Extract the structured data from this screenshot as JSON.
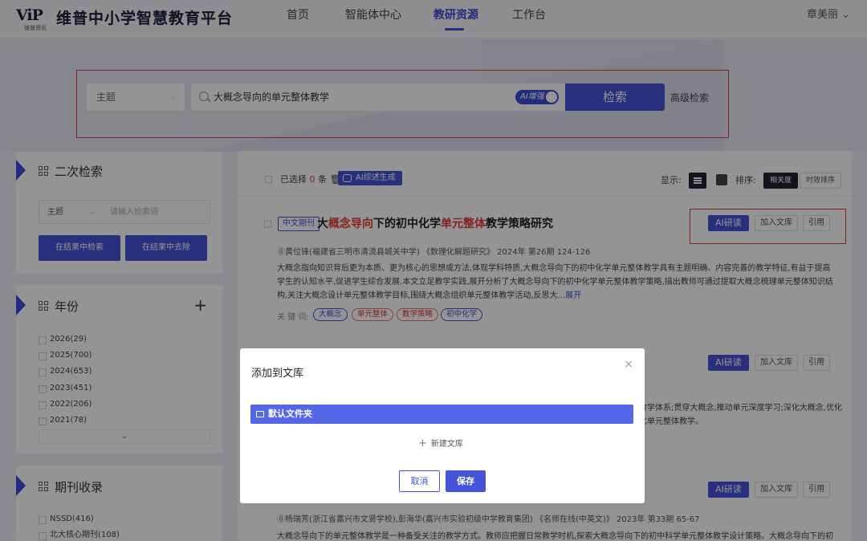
{
  "header": {
    "logo_mark": "ViP",
    "logo_sub": "维普资讯",
    "title": "维普中小学智慧教育平台",
    "nav": [
      "首页",
      "智能体中心",
      "教研资源",
      "工作台"
    ],
    "active_nav": "教研资源",
    "user": "章美丽 ⌄"
  },
  "search": {
    "subject": "主题",
    "query": "大概念导向的单元整体教学",
    "ai_toggle": "AI增强",
    "button": "检索",
    "advanced": "高级检索"
  },
  "sidebar": {
    "secondary": {
      "title": "二次检索",
      "field": "主题",
      "placeholder": "请输入检索词",
      "btn_in": "在结果中检索",
      "btn_out": "在结果中去除"
    },
    "year": {
      "title": "年份",
      "items": [
        "2026(29)",
        "2025(700)",
        "2024(653)",
        "2023(451)",
        "2022(206)",
        "2021(78)"
      ]
    },
    "journal": {
      "title": "期刊收录",
      "items": [
        "NSSD(416)",
        "北大核心期刊(108)"
      ]
    }
  },
  "toolbar": {
    "selected_prefix": "已选择",
    "selected_count": "0",
    "selected_suffix": "条",
    "ai_summary": "AI综述生成",
    "display_label": "显示:",
    "sort_label": "排序:",
    "sort_relevance": "相关度",
    "sort_time": "时效排序"
  },
  "results": [
    {
      "tag": "中文期刊",
      "title_parts": [
        "大",
        "概念导向",
        "下的初中化学",
        "单元整体",
        "教学策略研究"
      ],
      "meta": "⓪黄位锋(福建省三明市清流县城关中学)   《数理化解题研究》   2024年 第26期 124-126",
      "abstract": "大概念指向知识背后更为本质、更为核心的思想或方法,体现学科特质,大概念导向下的初中化学单元整体教学具有主题明确、内容完善的教学特征,有益于提高学生的认知水平,促进学生综合发展.本文立足教学实践,展开分析了大概念导向下的初中化学单元整体教学策略,描出教师可通过提取大概念梳理单元整体知识结构,关注大概念设计单元整体教学目标,围绕大概念组织单元整体教学活动,反思大...",
      "more": "展开",
      "kw_label": "关 键 词:",
      "keywords": [
        "大概念",
        "单元整体",
        "教学策略",
        "初中化学"
      ],
      "ai_read": "AI研读",
      "add_lib": "加入文库",
      "cite": "引用"
    },
    {
      "ai_read": "AI研读",
      "add_lib": "加入文库",
      "cite": "引用",
      "abstract_frag_1": "教学体系;贯穿大概念,推动单元深度学习;深化大概念,优化",
      "abstract_frag_2": "化单元整体教学。"
    },
    {
      "ai_read": "AI研读",
      "add_lib": "加入文库",
      "cite": "引用",
      "meta": "⓪杨瑞芳(浙江省嘉兴市文贤学校),彭海华(嘉兴市实验初级中学教育集团)   《名师在线(中英文)》   2023年 第33期 65-67",
      "abstract": "大概念导向下的单元整体教学是一种备受关注的教学方式。教师应把握日常教学时机,探索大概念导向下的初中科学单元整体教学设计策略。大概念导向下的初中科学单元整"
    }
  ],
  "modal": {
    "title": "添加到文库",
    "close": "×",
    "folder": "默认文件夹",
    "new_lib": "新建文库",
    "cancel": "取消",
    "save": "保存"
  },
  "colors": {
    "accent": "#4654d9",
    "highlight": "#e53935",
    "annotation_box": "#e53935"
  }
}
